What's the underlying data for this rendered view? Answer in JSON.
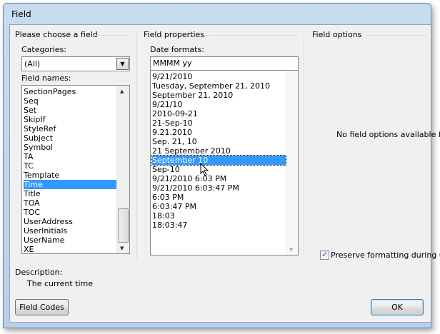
{
  "window": {
    "title": "Field"
  },
  "left": {
    "group": "Please choose a field",
    "categories_label": "Categories:",
    "categories_value": "(All)",
    "field_names_label": "Field names:",
    "field_names": [
      "SectionPages",
      "Seq",
      "Set",
      "SkipIf",
      "StyleRef",
      "Subject",
      "Symbol",
      "TA",
      "TC",
      "Template",
      "Time",
      "Title",
      "TOA",
      "TOC",
      "UserAddress",
      "UserInitials",
      "UserName",
      "XE"
    ],
    "selected": "Time",
    "description_label": "Description:",
    "description": "The current time"
  },
  "middle": {
    "group": "Field properties",
    "date_formats_label": "Date formats:",
    "date_format_value": "MMMM yy",
    "formats": [
      "9/21/2010",
      "Tuesday, September 21, 2010",
      "September 21, 2010",
      "9/21/10",
      "2010-09-21",
      "21-Sep-10",
      "9.21.2010",
      "Sep. 21, 10",
      "21 September 2010",
      "September 10",
      "Sep-10",
      "9/21/2010 6:03 PM",
      "9/21/2010 6:03:47 PM",
      "6:03 PM",
      "6:03:47 PM",
      "18:03",
      "18:03:47"
    ],
    "selected": "September 10"
  },
  "right": {
    "group": "Field options",
    "no_options": "No field options available f",
    "preserve_label": "Preserve formatting during u",
    "preserve_checked": true
  },
  "buttons": {
    "field_codes": "Field Codes",
    "ok": "OK"
  },
  "colors": {
    "selection": "#3399ff"
  }
}
